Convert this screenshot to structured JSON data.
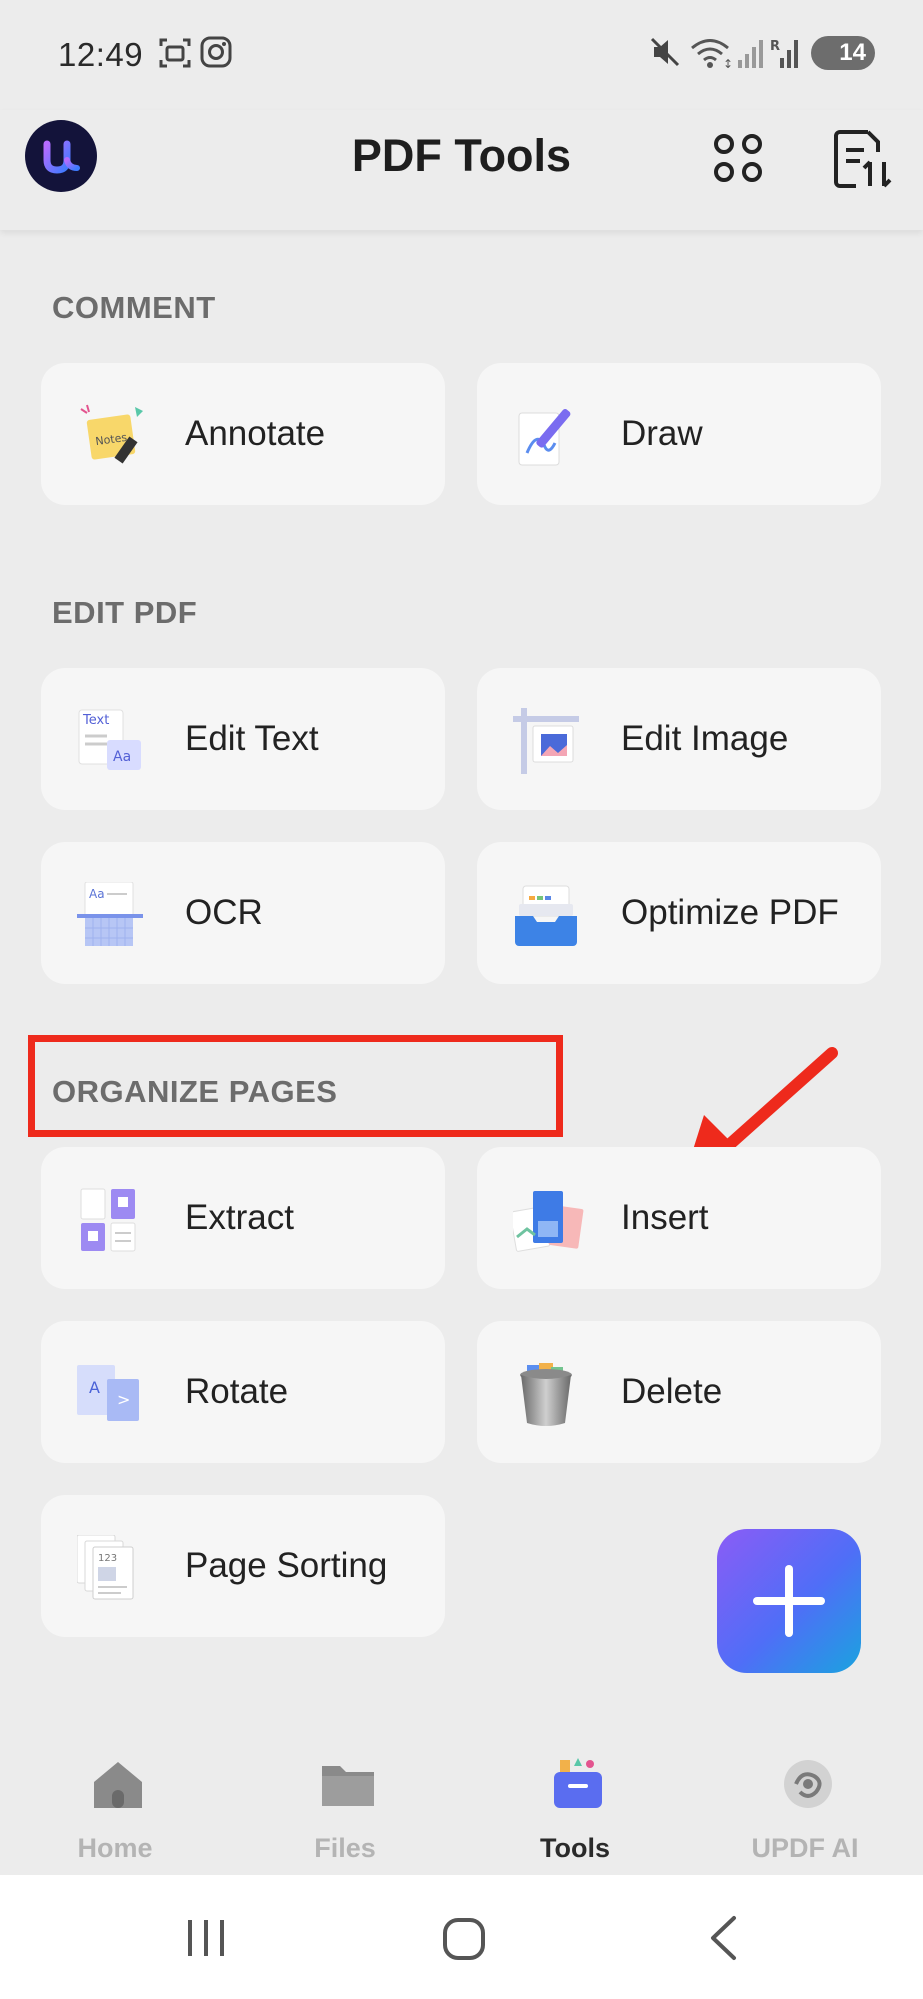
{
  "status": {
    "time": "12:49",
    "battery": "14"
  },
  "header": {
    "title": "PDF Tools"
  },
  "sections": {
    "comment": {
      "title": "COMMENT",
      "items": [
        {
          "label": "Annotate",
          "icon": "annotate-notes-icon"
        },
        {
          "label": "Draw",
          "icon": "draw-pen-icon"
        }
      ]
    },
    "edit": {
      "title": "EDIT PDF",
      "items": [
        {
          "label": "Edit Text",
          "icon": "edit-text-icon"
        },
        {
          "label": "Edit Image",
          "icon": "edit-image-icon"
        },
        {
          "label": "OCR",
          "icon": "ocr-scan-icon"
        },
        {
          "label": "Optimize PDF",
          "icon": "optimize-tray-icon"
        }
      ]
    },
    "organize": {
      "title": "ORGANIZE PAGES",
      "items": [
        {
          "label": "Extract",
          "icon": "extract-pages-icon"
        },
        {
          "label": "Insert",
          "icon": "insert-pages-icon"
        },
        {
          "label": "Rotate",
          "icon": "rotate-page-icon"
        },
        {
          "label": "Delete",
          "icon": "trash-bin-icon"
        },
        {
          "label": "Page Sorting",
          "icon": "page-sorting-icon"
        }
      ]
    }
  },
  "icon_text": {
    "annotate": "Notes",
    "edit_text_top": "Text",
    "edit_text_bottom": "Aa",
    "ocr": "Aa",
    "rotate_left": "A",
    "rotate_right": ">",
    "sorting": "123"
  },
  "nav": {
    "items": [
      {
        "label": "Home",
        "icon": "home-icon"
      },
      {
        "label": "Files",
        "icon": "folder-icon"
      },
      {
        "label": "Tools",
        "icon": "tools-icon"
      },
      {
        "label": "UPDF AI",
        "icon": "ai-swirl-icon"
      }
    ],
    "active": "Tools"
  },
  "colors": {
    "accent": "#6a5cf0",
    "highlight": "#ee2a1c",
    "background": "#ececec",
    "card": "#f6f6f6"
  }
}
